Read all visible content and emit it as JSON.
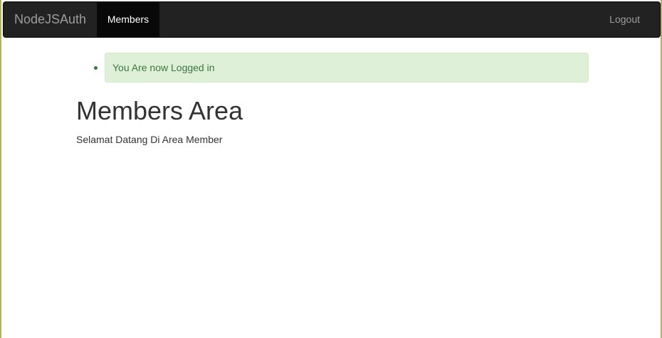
{
  "navbar": {
    "brand": "NodeJSAuth",
    "items": [
      {
        "label": "Members",
        "active": true
      }
    ],
    "right_items": [
      {
        "label": "Logout"
      }
    ]
  },
  "messages": [
    {
      "text": "You Are now Logged in",
      "type": "success"
    }
  ],
  "main": {
    "title": "Members Area",
    "text": "Selamat Datang Di Area Member"
  },
  "colors": {
    "navbar_bg": "#222222",
    "active_nav_bg": "#080808",
    "success_bg": "#dff0d8",
    "success_text": "#3c763d",
    "text": "#333333"
  }
}
